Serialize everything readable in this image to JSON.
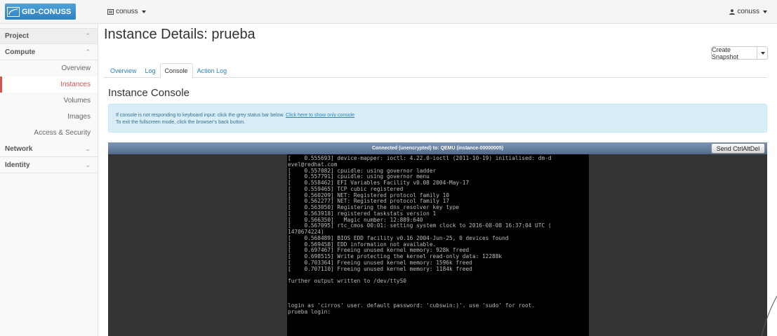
{
  "navbar": {
    "brand": "GID-CONUSS",
    "project": "conuss",
    "user": "conuss"
  },
  "sidebar": {
    "project": "Project",
    "compute": "Compute",
    "items": [
      {
        "label": "Overview"
      },
      {
        "label": "Instances"
      },
      {
        "label": "Volumes"
      },
      {
        "label": "Images"
      },
      {
        "label": "Access & Security"
      }
    ],
    "network": "Network",
    "identity": "Identity"
  },
  "page": {
    "title": "Instance Details: prueba",
    "snapshot_button": "Create Snapshot",
    "tabs": [
      "Overview",
      "Log",
      "Console",
      "Action Log"
    ],
    "console_title": "Instance Console"
  },
  "alert": {
    "line1": "If console is not responding to keyboard input: click the grey status bar below.",
    "link": "Click here to show only console",
    "line2": "To exit the fullscreen mode, click the browser's back button."
  },
  "console": {
    "status": "Connected (unencrypted) to: QEMU (instance-00000005)",
    "ctrl_button": "Send CtrlAltDel",
    "lines": [
      "[    0.555693] device-mapper: ioctl: 4.22.0-ioctl (2011-10-19) initialised: dm-d",
      "evel@redhat.com",
      "[    0.557082] cpuidle: using governor ladder",
      "[    0.557791] cpuidle: using governor menu",
      "[    0.558462] EFI Variables Facility v0.08 2004-May-17",
      "[    0.559465] TCP cubic registered",
      "[    0.560209] NET: Registered protocol family 10",
      "[    0.562277] NET: Registered protocol family 17",
      "[    0.563050] Registering the dns_resolver key type",
      "[    0.563918] registered taskstats version 1",
      "[    0.566350]   Magic number: 12:889:640",
      "[    0.567095] rtc_cmos 00:01: setting system clock to 2016-08-08 16:37:04 UTC (",
      "1470674224)",
      "[    0.568489] BIOS EDD facility v0.16 2004-Jun-25, 0 devices found",
      "[    0.569458] EDD information not available.",
      "[    0.697467] Freeing unused kernel memory: 928k freed",
      "[    0.698515] Write protecting the kernel read-only data: 12288k",
      "[    0.703364] Freeing unused kernel memory: 1596k freed",
      "[    0.707110] Freeing unused kernel memory: 1184k freed",
      "",
      "further output written to /dev/ttyS0",
      "",
      "",
      "",
      "login as 'cirros' user. default password: 'cubswin:)'. use 'sudo' for root.",
      "prueba login:"
    ]
  }
}
